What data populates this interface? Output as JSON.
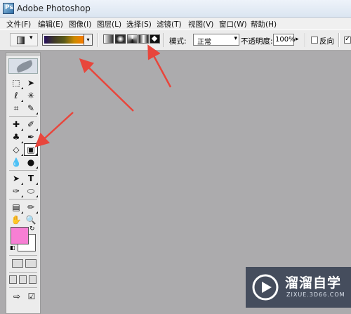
{
  "app": {
    "title": "Adobe Photoshop",
    "icon": "photoshop-app-icon"
  },
  "menu": [
    "文件(F)",
    "编辑(E)",
    "图像(I)",
    "图层(L)",
    "选择(S)",
    "滤镜(T)",
    "视图(V)",
    "窗口(W)",
    "帮助(H)"
  ],
  "options": {
    "tool_preset_icon": "gradient-tool-icon",
    "gradient_picker": {
      "colors": [
        "#26105d",
        "#3f3a28",
        "#5a5a1a",
        "#c98a00",
        "#ff7a00"
      ]
    },
    "gradient_types": [
      "linear",
      "radial",
      "angle",
      "reflected",
      "diamond"
    ],
    "mode_label": "模式:",
    "mode_value": "正常",
    "opacity_label": "不透明度:",
    "opacity_value": "100%",
    "reverse_label": "反向",
    "reverse_checked": false,
    "dither_checked": true
  },
  "toolbox": {
    "active_tool": "gradient-tool",
    "foreground_color": "#f77fd4",
    "background_color": "#ffffff",
    "tools": [
      "rectangular-marquee",
      "move",
      "lasso",
      "magic-wand",
      "crop",
      "slice",
      "healing-brush",
      "brush",
      "clone-stamp",
      "history-brush",
      "eraser",
      "gradient",
      "blur",
      "dodge",
      "path-selection",
      "type",
      "pen",
      "ellipse",
      "notes",
      "eyedropper",
      "hand",
      "zoom"
    ]
  },
  "annotations": {
    "arrow_color": "#e8463c",
    "count": 3
  },
  "watermark": {
    "text": "溜溜自学",
    "subtext": "ZIXUE.3D66.COM",
    "logo": "play-icon"
  }
}
